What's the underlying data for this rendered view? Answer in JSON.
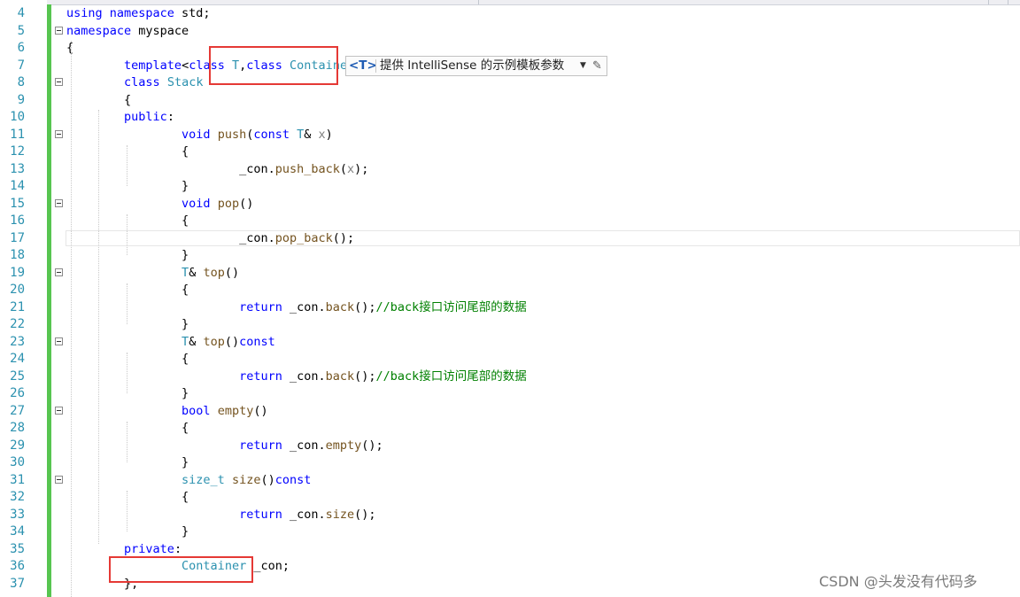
{
  "editor": {
    "lines": [
      {
        "num": "4",
        "fold": false,
        "tokens": [
          [
            "kw",
            "using namespace "
          ],
          [
            "",
            "std;"
          ]
        ]
      },
      {
        "num": "5",
        "fold": true,
        "tokens": [
          [
            "kw",
            "namespace "
          ],
          [
            "",
            "myspace"
          ]
        ]
      },
      {
        "num": "6",
        "fold": false,
        "tokens": [
          [
            "",
            "{"
          ]
        ]
      },
      {
        "num": "7",
        "fold": false,
        "tokens": [
          [
            "",
            "        "
          ],
          [
            "kw",
            "template"
          ],
          [
            "",
            "<"
          ],
          [
            "kw",
            "class "
          ],
          [
            "ty",
            "T"
          ],
          [
            "",
            ","
          ],
          [
            "kw",
            "class "
          ],
          [
            "ty",
            "Container"
          ],
          [
            "pm",
            " >"
          ]
        ]
      },
      {
        "num": "8",
        "fold": true,
        "tokens": [
          [
            "",
            "        "
          ],
          [
            "kw",
            "class "
          ],
          [
            "ty",
            "Stack"
          ]
        ]
      },
      {
        "num": "9",
        "fold": false,
        "tokens": [
          [
            "",
            "        {"
          ]
        ]
      },
      {
        "num": "10",
        "fold": false,
        "tokens": [
          [
            "",
            "        "
          ],
          [
            "kw",
            "public"
          ],
          [
            "",
            ":"
          ]
        ]
      },
      {
        "num": "11",
        "fold": true,
        "tokens": [
          [
            "",
            "                "
          ],
          [
            "kw",
            "void "
          ],
          [
            "fn",
            "push"
          ],
          [
            "",
            "("
          ],
          [
            "kw",
            "const "
          ],
          [
            "ty",
            "T"
          ],
          [
            "",
            "& "
          ],
          [
            "pm",
            "x"
          ],
          [
            "",
            ")"
          ]
        ]
      },
      {
        "num": "12",
        "fold": false,
        "tokens": [
          [
            "",
            "                {"
          ]
        ]
      },
      {
        "num": "13",
        "fold": false,
        "tokens": [
          [
            "",
            "                        _con."
          ],
          [
            "fn",
            "push_back"
          ],
          [
            "",
            "("
          ],
          [
            "pm",
            "x"
          ],
          [
            "",
            ");"
          ]
        ]
      },
      {
        "num": "14",
        "fold": false,
        "tokens": [
          [
            "",
            "                }"
          ]
        ]
      },
      {
        "num": "15",
        "fold": true,
        "tokens": [
          [
            "",
            "                "
          ],
          [
            "kw",
            "void "
          ],
          [
            "fn",
            "pop"
          ],
          [
            "",
            "()"
          ]
        ]
      },
      {
        "num": "16",
        "fold": false,
        "tokens": [
          [
            "",
            "                {"
          ]
        ]
      },
      {
        "num": "17",
        "fold": false,
        "tokens": [
          [
            "",
            "                        _con."
          ],
          [
            "fn",
            "pop_back"
          ],
          [
            "",
            "();"
          ]
        ]
      },
      {
        "num": "18",
        "fold": false,
        "tokens": [
          [
            "",
            "                }"
          ]
        ]
      },
      {
        "num": "19",
        "fold": true,
        "tokens": [
          [
            "",
            "                "
          ],
          [
            "ty",
            "T"
          ],
          [
            "",
            "& "
          ],
          [
            "fn",
            "top"
          ],
          [
            "",
            "()"
          ]
        ]
      },
      {
        "num": "20",
        "fold": false,
        "tokens": [
          [
            "",
            "                {"
          ]
        ]
      },
      {
        "num": "21",
        "fold": false,
        "tokens": [
          [
            "",
            "                        "
          ],
          [
            "kw",
            "return "
          ],
          [
            "",
            "_con."
          ],
          [
            "fn",
            "back"
          ],
          [
            "",
            "();"
          ],
          [
            "cm",
            "//back接口访问尾部的数据"
          ]
        ]
      },
      {
        "num": "22",
        "fold": false,
        "tokens": [
          [
            "",
            "                }"
          ]
        ]
      },
      {
        "num": "23",
        "fold": true,
        "tokens": [
          [
            "",
            "                "
          ],
          [
            "ty",
            "T"
          ],
          [
            "",
            "& "
          ],
          [
            "fn",
            "top"
          ],
          [
            "",
            "()"
          ],
          [
            "kw",
            "const"
          ]
        ]
      },
      {
        "num": "24",
        "fold": false,
        "tokens": [
          [
            "",
            "                {"
          ]
        ]
      },
      {
        "num": "25",
        "fold": false,
        "tokens": [
          [
            "",
            "                        "
          ],
          [
            "kw",
            "return "
          ],
          [
            "",
            "_con."
          ],
          [
            "fn",
            "back"
          ],
          [
            "",
            "();"
          ],
          [
            "cm",
            "//back接口访问尾部的数据"
          ]
        ]
      },
      {
        "num": "26",
        "fold": false,
        "tokens": [
          [
            "",
            "                }"
          ]
        ]
      },
      {
        "num": "27",
        "fold": true,
        "tokens": [
          [
            "",
            "                "
          ],
          [
            "kw",
            "bool "
          ],
          [
            "fn",
            "empty"
          ],
          [
            "",
            "()"
          ]
        ]
      },
      {
        "num": "28",
        "fold": false,
        "tokens": [
          [
            "",
            "                {"
          ]
        ]
      },
      {
        "num": "29",
        "fold": false,
        "tokens": [
          [
            "",
            "                        "
          ],
          [
            "kw",
            "return "
          ],
          [
            "",
            "_con."
          ],
          [
            "fn",
            "empty"
          ],
          [
            "",
            "();"
          ]
        ]
      },
      {
        "num": "30",
        "fold": false,
        "tokens": [
          [
            "",
            "                }"
          ]
        ]
      },
      {
        "num": "31",
        "fold": true,
        "tokens": [
          [
            "",
            "                "
          ],
          [
            "ty",
            "size_t "
          ],
          [
            "fn",
            "size"
          ],
          [
            "",
            "()"
          ],
          [
            "kw",
            "const"
          ]
        ]
      },
      {
        "num": "32",
        "fold": false,
        "tokens": [
          [
            "",
            "                {"
          ]
        ]
      },
      {
        "num": "33",
        "fold": false,
        "tokens": [
          [
            "",
            "                        "
          ],
          [
            "kw",
            "return "
          ],
          [
            "",
            "_con."
          ],
          [
            "fn",
            "size"
          ],
          [
            "",
            "();"
          ]
        ]
      },
      {
        "num": "34",
        "fold": false,
        "tokens": [
          [
            "",
            "                }"
          ]
        ]
      },
      {
        "num": "35",
        "fold": false,
        "tokens": [
          [
            "",
            "        "
          ],
          [
            "kw",
            "private"
          ],
          [
            "",
            ":"
          ]
        ]
      },
      {
        "num": "36",
        "fold": false,
        "tokens": [
          [
            "",
            "                "
          ],
          [
            "ty",
            "Container "
          ],
          [
            "",
            "_con;"
          ]
        ]
      },
      {
        "num": "37",
        "fold": false,
        "tokens": [
          [
            "",
            "        };"
          ]
        ]
      }
    ]
  },
  "intellisense_hint": {
    "tag": "<T>",
    "text": "提供 IntelliSense 的示例模板参数",
    "dropdown_icon": "dropdown-arrow-icon",
    "edit_icon": "pencil-icon"
  },
  "watermark": "CSDN @头发没有代码多",
  "colors": {
    "keyword": "#0000ff",
    "type": "#2b91af",
    "function": "#74531f",
    "parameter": "#808080",
    "comment": "#008000",
    "line_number": "#2b91af",
    "change_bar": "#57c550",
    "highlight_box": "#e53935"
  }
}
